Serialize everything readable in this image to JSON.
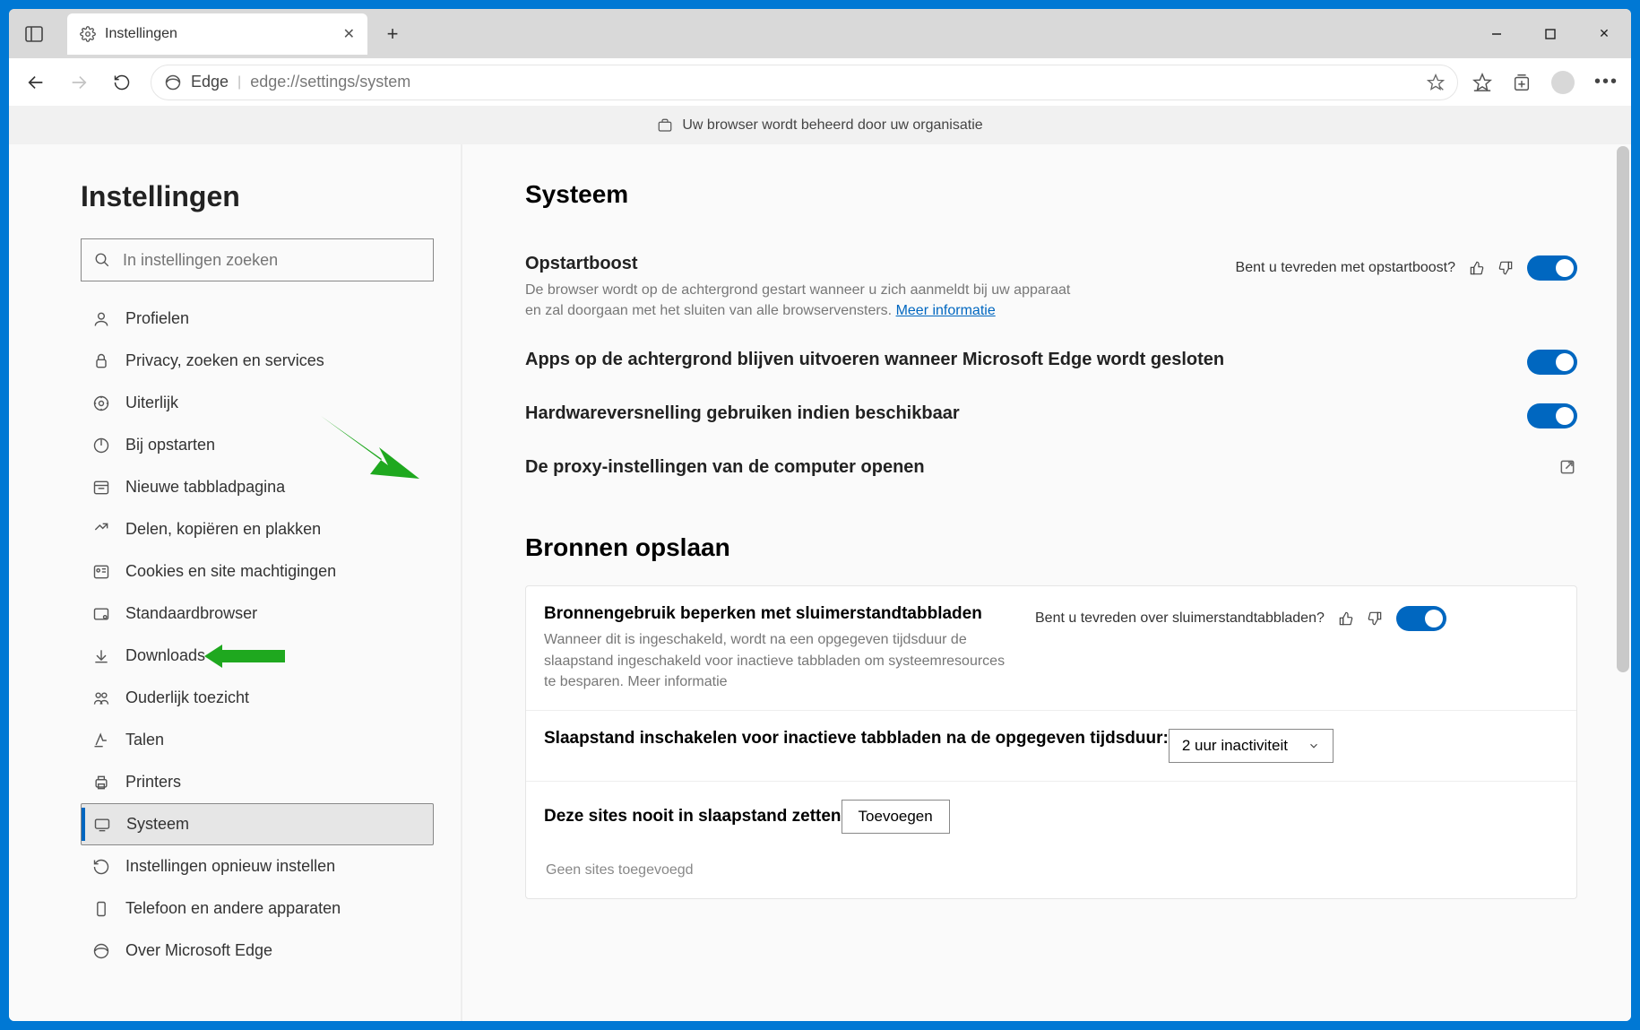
{
  "titlebar": {
    "tab_title": "Instellingen"
  },
  "toolbar": {
    "edge_label": "Edge",
    "url": "edge://settings/system"
  },
  "orgbar": {
    "text": "Uw browser wordt beheerd door uw organisatie"
  },
  "sidebar": {
    "heading": "Instellingen",
    "search_placeholder": "In instellingen zoeken",
    "items": [
      {
        "label": "Profielen"
      },
      {
        "label": "Privacy, zoeken en services"
      },
      {
        "label": "Uiterlijk"
      },
      {
        "label": "Bij opstarten"
      },
      {
        "label": "Nieuwe tabbladpagina"
      },
      {
        "label": "Delen, kopiëren en plakken"
      },
      {
        "label": "Cookies en site machtigingen"
      },
      {
        "label": "Standaardbrowser"
      },
      {
        "label": "Downloads"
      },
      {
        "label": "Ouderlijk toezicht"
      },
      {
        "label": "Talen"
      },
      {
        "label": "Printers"
      },
      {
        "label": "Systeem"
      },
      {
        "label": "Instellingen opnieuw instellen"
      },
      {
        "label": "Telefoon en andere apparaten"
      },
      {
        "label": "Over Microsoft Edge"
      }
    ]
  },
  "main": {
    "section1": {
      "heading": "Systeem",
      "startup": {
        "title": "Opstartboost",
        "desc": "De browser wordt op de achtergrond gestart wanneer u zich aanmeldt bij uw apparaat en zal doorgaan met het sluiten van alle browservensters. ",
        "link": "Meer informatie",
        "feedback_q": "Bent u tevreden met opstartboost?"
      },
      "bg_apps": {
        "title": "Apps op de achtergrond blijven uitvoeren wanneer Microsoft Edge wordt gesloten"
      },
      "hw_accel": {
        "title": "Hardwareversnelling gebruiken indien beschikbaar"
      },
      "proxy": {
        "title": "De proxy-instellingen van de computer openen"
      }
    },
    "section2": {
      "heading": "Bronnen opslaan",
      "sleep": {
        "title": "Bronnengebruik beperken met sluimerstandtabbladen",
        "desc": "Wanneer dit is ingeschakeld, wordt na een opgegeven tijdsduur de slaapstand ingeschakeld voor inactieve tabbladen om systeemresources te besparen. ",
        "link": "Meer informatie",
        "feedback_q": "Bent u tevreden over sluimerstandtabbladen?"
      },
      "timeout": {
        "title": "Slaapstand inschakelen voor inactieve tabbladen na de opgegeven tijdsduur:",
        "value": "2 uur inactiviteit"
      },
      "never": {
        "title": "Deze sites nooit in slaapstand zetten",
        "button": "Toevoegen",
        "empty": "Geen sites toegevoegd"
      }
    }
  }
}
